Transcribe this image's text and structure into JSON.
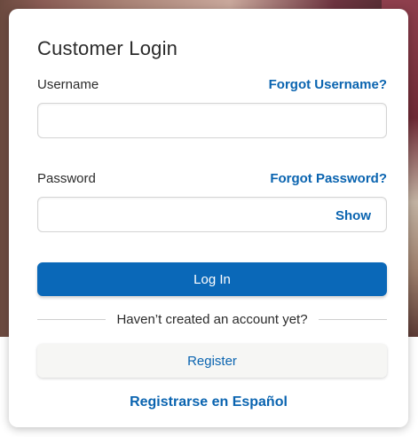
{
  "login": {
    "title": "Customer Login",
    "username_label": "Username",
    "forgot_username": "Forgot Username?",
    "username_value": "",
    "password_label": "Password",
    "forgot_password": "Forgot Password?",
    "password_value": "",
    "show_label": "Show",
    "login_button": "Log In",
    "divider_text": "Haven’t created an account yet?",
    "register_button": "Register",
    "spanish_link": "Registrarse en Español"
  },
  "colors": {
    "primary": "#0a68b8",
    "link": "#0a64b0",
    "text": "#2b2b2b",
    "secondary_button_bg": "#f6f6f4"
  }
}
